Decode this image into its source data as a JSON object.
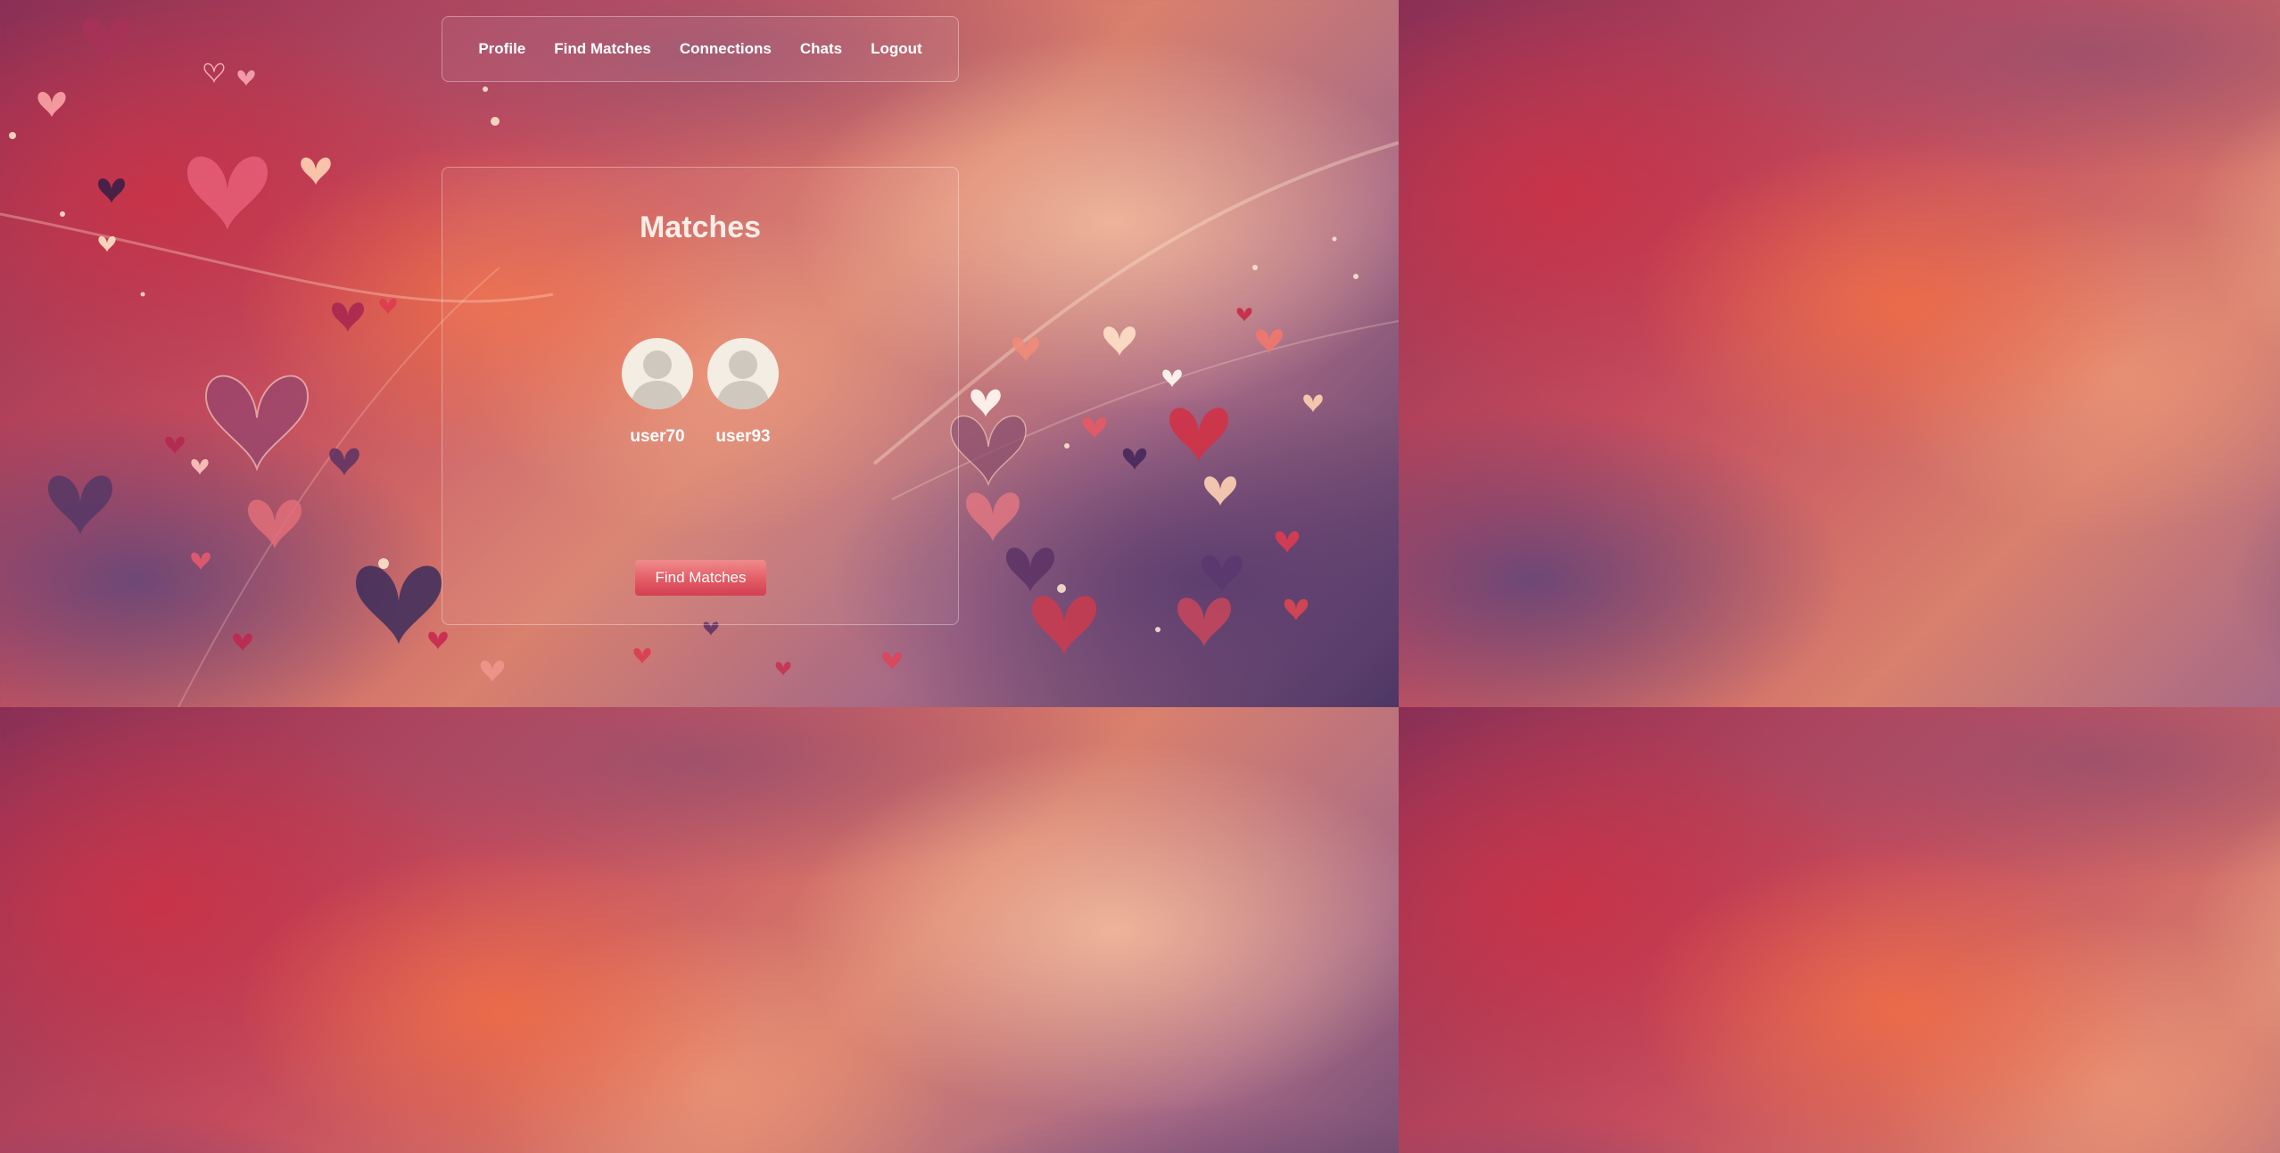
{
  "nav": {
    "items": [
      {
        "label": "Profile"
      },
      {
        "label": "Find Matches"
      },
      {
        "label": "Connections"
      },
      {
        "label": "Chats"
      },
      {
        "label": "Logout"
      }
    ]
  },
  "matches": {
    "title": "Matches",
    "users": [
      {
        "username": "user70",
        "avatar_icon": "default-user-avatar"
      },
      {
        "username": "user93",
        "avatar_icon": "default-user-avatar"
      }
    ],
    "find_button_label": "Find Matches"
  },
  "theme": {
    "text_color": "#ffffff",
    "title_color": "#fbeee6",
    "button_color": "#e45a64",
    "avatar_bg": "#f3ede4",
    "avatar_fg": "#cfc8bf",
    "background_icon": "hearts-pattern"
  }
}
